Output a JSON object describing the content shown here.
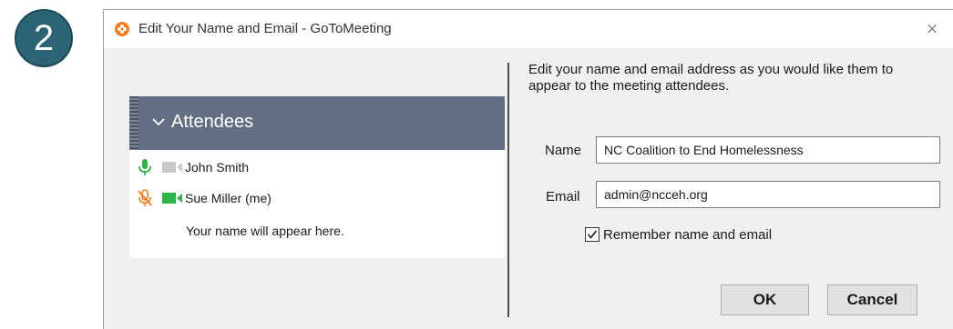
{
  "step": {
    "number": "2"
  },
  "dialog": {
    "title": "Edit Your Name and Email - GoToMeeting",
    "close_glyph": "×",
    "app_icon": "gotomeeting-flower-icon"
  },
  "attendees": {
    "header": "Attendees",
    "items": [
      {
        "name": "John Smith",
        "mic": "on",
        "camera": "off"
      },
      {
        "name": "Sue Miller (me)",
        "mic": "muted",
        "camera": "on"
      }
    ],
    "hint": "Your name will appear here."
  },
  "form": {
    "instructions": "Edit your name and email address as you would like them to appear to the meeting attendees.",
    "name_label": "Name",
    "name_value": "NC Coalition to End Homelessness",
    "email_label": "Email",
    "email_value": "admin@ncceh.org",
    "remember_label": "Remember name and email",
    "remember_checked": true,
    "ok_label": "OK",
    "cancel_label": "Cancel"
  },
  "colors": {
    "badge": "#2d6473",
    "header_bg": "#636e82",
    "mic_on": "#2eb24a",
    "mic_muted": "#f47c20",
    "camera_on": "#2eb24a",
    "camera_off": "#c8c8c8",
    "app_icon": "#f47c20"
  }
}
